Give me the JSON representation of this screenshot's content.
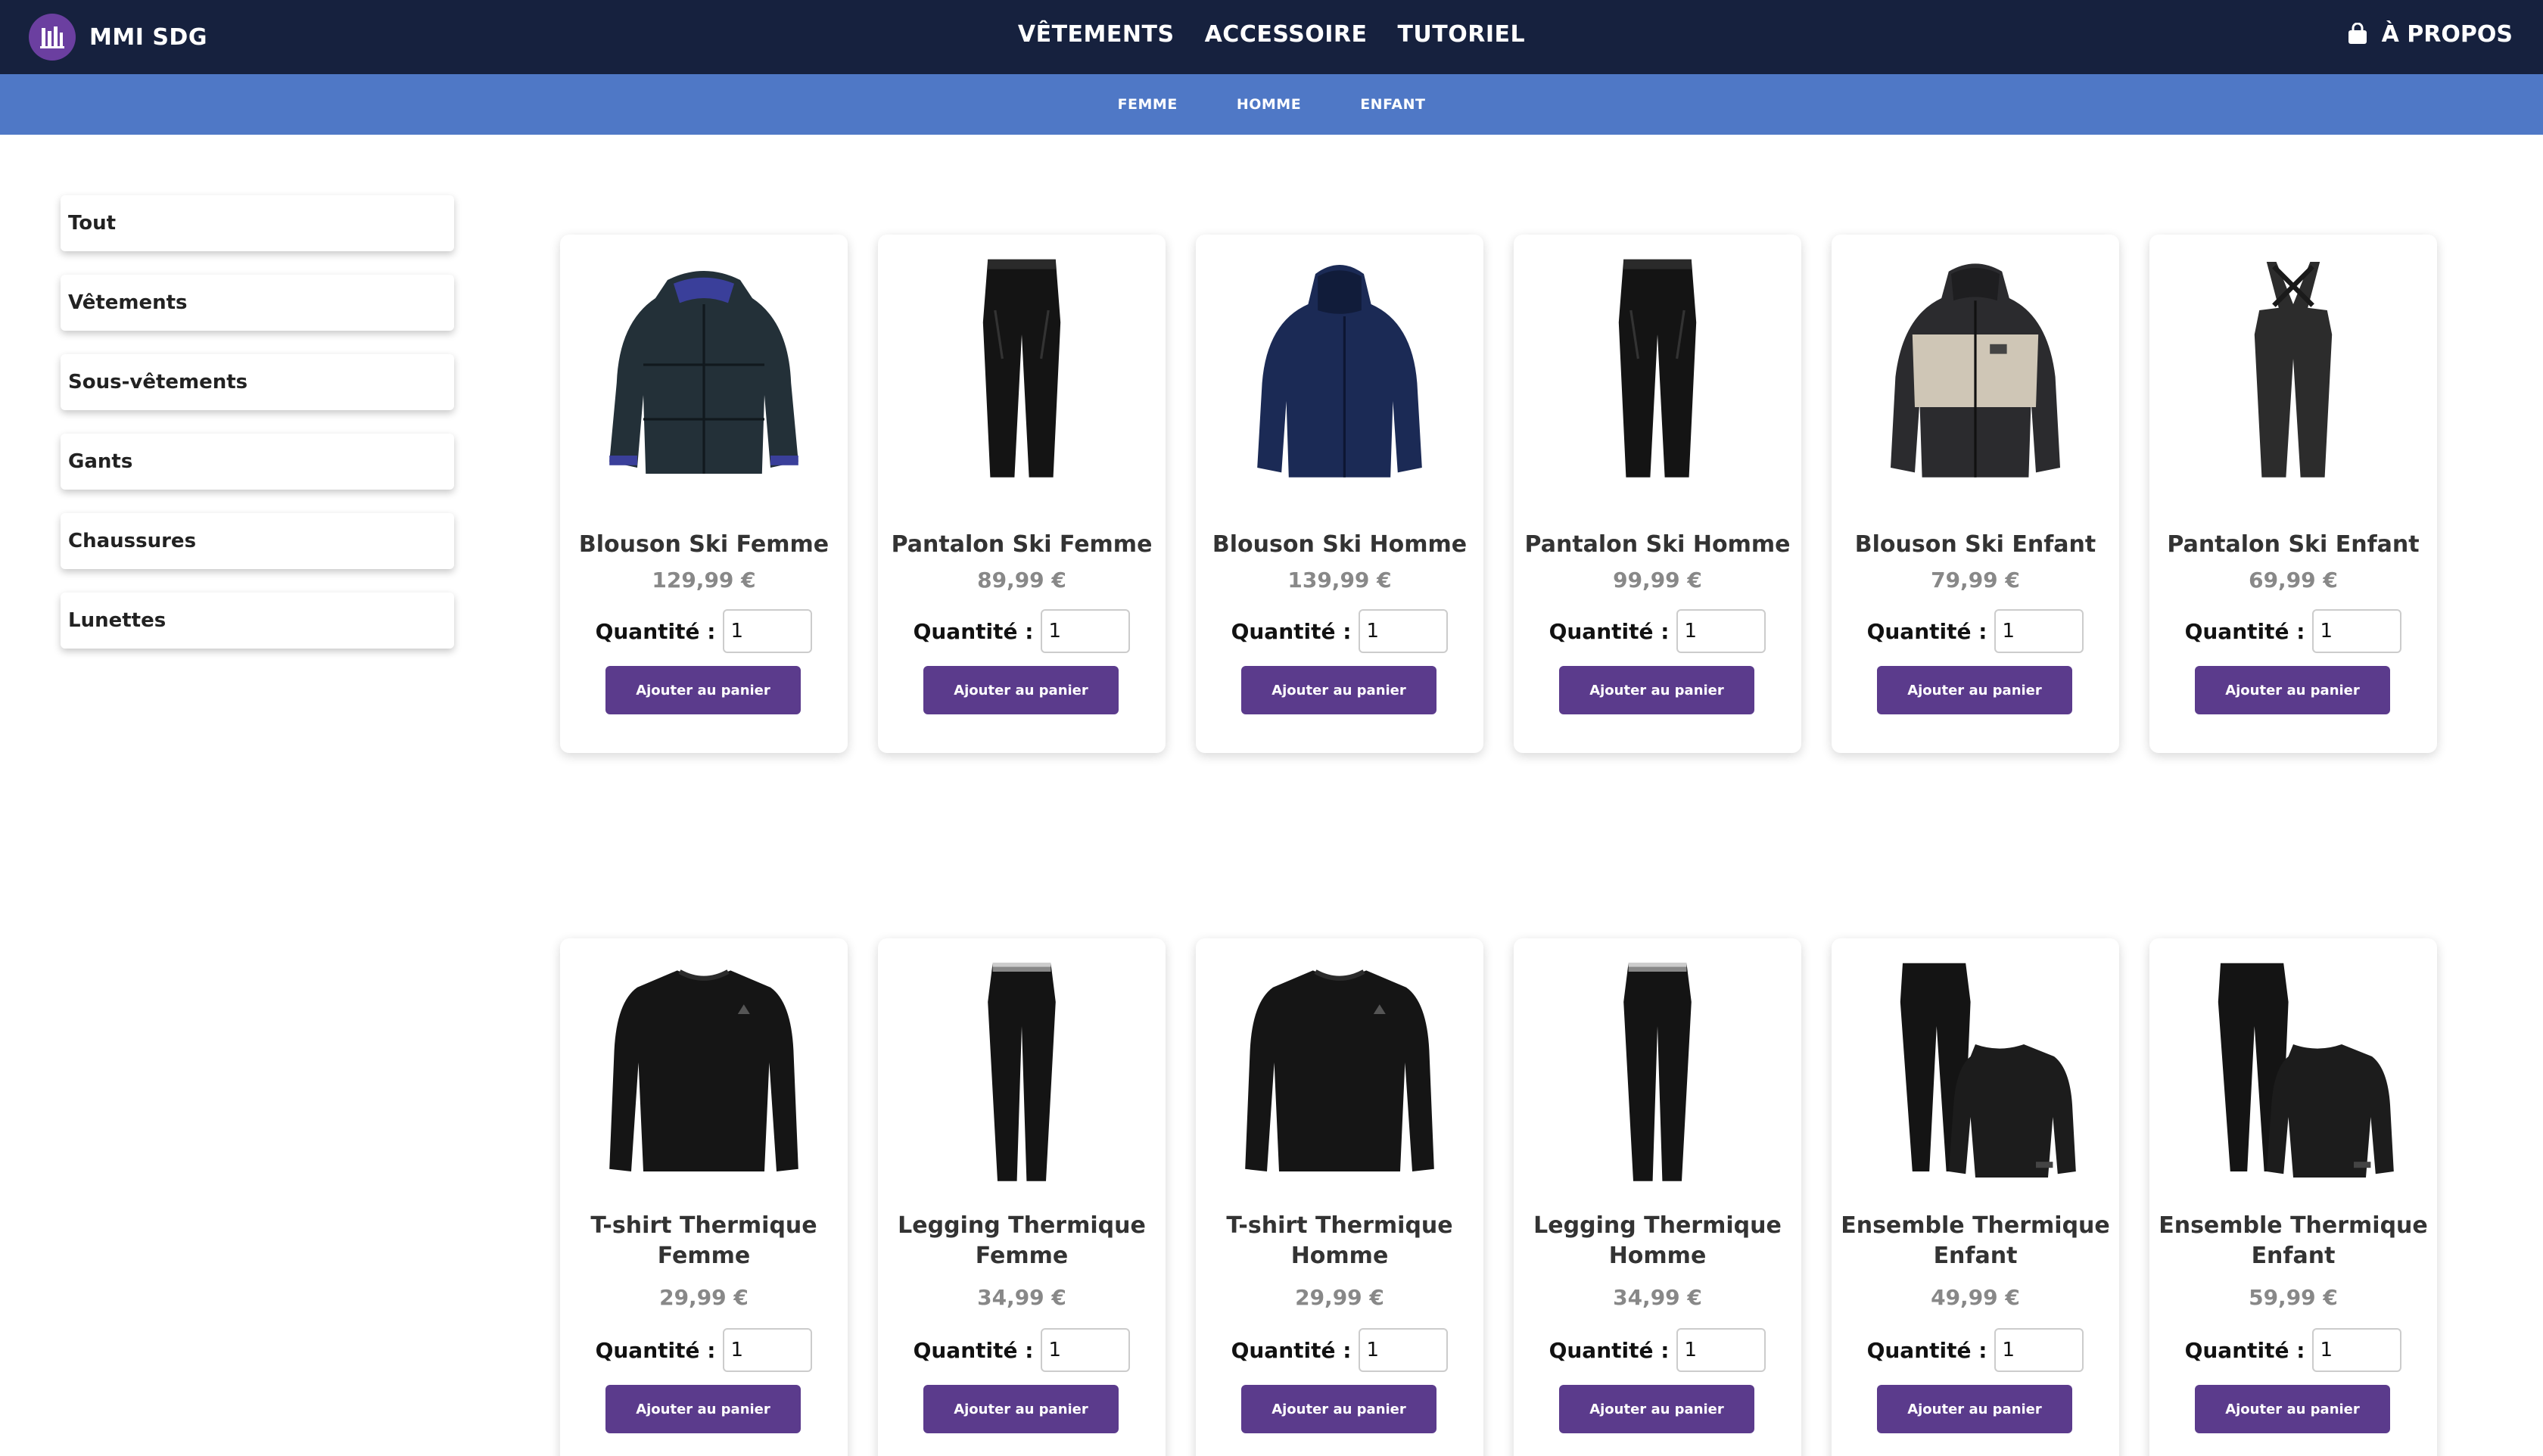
{
  "brand": {
    "name": "MMI SDG"
  },
  "nav": {
    "items": [
      "VÊTEMENTS",
      "ACCESSOIRE",
      "TUTORIEL"
    ],
    "about": "À PROPOS"
  },
  "subnav": {
    "items": [
      "FEMME",
      "HOMME",
      "ENFANT"
    ]
  },
  "sidebar": {
    "items": [
      "Tout",
      "Vêtements",
      "Sous-vêtements",
      "Gants",
      "Chaussures",
      "Lunettes"
    ]
  },
  "products": [
    {
      "name": "Blouson Ski Femme",
      "price": "129,99 €",
      "qty_label": "Quantité :",
      "qty": "1",
      "button": "Ajouter au panier",
      "icon": "puffer-jacket"
    },
    {
      "name": "Pantalon Ski Femme",
      "price": "89,99 €",
      "qty_label": "Quantité :",
      "qty": "1",
      "button": "Ajouter au panier",
      "icon": "ski-pants"
    },
    {
      "name": "Blouson Ski Homme",
      "price": "139,99 €",
      "qty_label": "Quantité :",
      "qty": "1",
      "button": "Ajouter au panier",
      "icon": "ski-jacket"
    },
    {
      "name": "Pantalon Ski Homme",
      "price": "99,99 €",
      "qty_label": "Quantité :",
      "qty": "1",
      "button": "Ajouter au panier",
      "icon": "ski-pants"
    },
    {
      "name": "Blouson Ski Enfant",
      "price": "79,99 €",
      "qty_label": "Quantité :",
      "qty": "1",
      "button": "Ajouter au panier",
      "icon": "kids-jacket"
    },
    {
      "name": "Pantalon Ski Enfant",
      "price": "69,99 €",
      "qty_label": "Quantité :",
      "qty": "1",
      "button": "Ajouter au panier",
      "icon": "bib-pants"
    },
    {
      "name": "T-shirt Thermique Femme",
      "price": "29,99 €",
      "qty_label": "Quantité :",
      "qty": "1",
      "button": "Ajouter au panier",
      "icon": "thermal-shirt"
    },
    {
      "name": "Legging Thermique Femme",
      "price": "34,99 €",
      "qty_label": "Quantité :",
      "qty": "1",
      "button": "Ajouter au panier",
      "icon": "legging"
    },
    {
      "name": "T-shirt Thermique Homme",
      "price": "29,99 €",
      "qty_label": "Quantité :",
      "qty": "1",
      "button": "Ajouter au panier",
      "icon": "thermal-shirt"
    },
    {
      "name": "Legging Thermique Homme",
      "price": "34,99 €",
      "qty_label": "Quantité :",
      "qty": "1",
      "button": "Ajouter au panier",
      "icon": "legging"
    },
    {
      "name": "Ensemble Thermique Enfant",
      "price": "49,99 €",
      "qty_label": "Quantité :",
      "qty": "1",
      "button": "Ajouter au panier",
      "icon": "thermal-set"
    },
    {
      "name": "Ensemble Thermique Enfant",
      "price": "59,99 €",
      "qty_label": "Quantité :",
      "qty": "1",
      "button": "Ajouter au panier",
      "icon": "thermal-set"
    }
  ],
  "colors": {
    "topbar": "#16213e",
    "subbar": "#4f78c6",
    "button": "#5b3b8c",
    "logo": "#6b3fa0"
  }
}
